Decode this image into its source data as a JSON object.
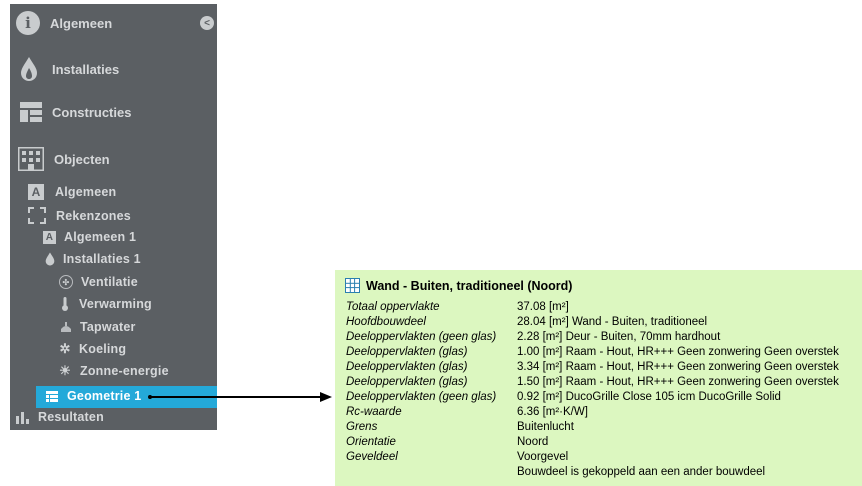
{
  "sidebar": {
    "collapse_glyph": "<",
    "sections": [
      {
        "label": "Algemeen",
        "icon": "info-icon"
      },
      {
        "label": "Installaties",
        "icon": "flame-icon"
      },
      {
        "label": "Constructies",
        "icon": "construction-icon"
      },
      {
        "label": "Objecten",
        "icon": "building-icon"
      }
    ],
    "items": [
      {
        "label": "Algemeen",
        "icon": "letter-a-icon",
        "glyph": "A"
      },
      {
        "label": "Rekenzones",
        "icon": "dashed-box-icon"
      },
      {
        "label": "Algemeen 1",
        "icon": "letter-a-icon",
        "glyph": "A"
      },
      {
        "label": "Installaties 1",
        "icon": "flame-icon"
      },
      {
        "label": "Ventilatie",
        "icon": "fan-icon"
      },
      {
        "label": "Verwarming",
        "icon": "thermometer-icon"
      },
      {
        "label": "Tapwater",
        "icon": "faucet-icon"
      },
      {
        "label": "Koeling",
        "icon": "snowflake-icon"
      },
      {
        "label": "Zonne-energie",
        "icon": "sun-icon"
      },
      {
        "label": "Geometrie 1",
        "icon": "grid-icon",
        "active": true
      },
      {
        "label": "Resultaten",
        "icon": "bar-chart-icon"
      }
    ],
    "active_color": "#24a9d9"
  },
  "panel": {
    "title": "Wand - Buiten, traditioneel (Noord)",
    "background": "#dcf7c0",
    "rows": [
      {
        "label": "Totaal oppervlakte",
        "value": "37.08 [m²]"
      },
      {
        "label": "Hoofdbouwdeel",
        "value": "28.04 [m²] Wand - Buiten, traditioneel"
      },
      {
        "label": "Deeloppervlakten (geen glas)",
        "value": "2.28 [m²] Deur - Buiten, 70mm hardhout"
      },
      {
        "label": "Deeloppervlakten (glas)",
        "value": "1.00 [m²] Raam - Hout, HR+++  Geen zonwering Geen overstek"
      },
      {
        "label": "Deeloppervlakten (glas)",
        "value": "3.34 [m²] Raam - Hout, HR+++  Geen zonwering Geen overstek"
      },
      {
        "label": "Deeloppervlakten (glas)",
        "value": "1.50 [m²] Raam - Hout, HR+++  Geen zonwering Geen overstek"
      },
      {
        "label": "Deeloppervlakten (geen glas)",
        "value": "0.92 [m²] DucoGrille Close 105 icm DucoGrille Solid"
      },
      {
        "label": "Rc-waarde",
        "value": "6.36 [m²·K/W]"
      },
      {
        "label": "Grens",
        "value": "Buitenlucht"
      },
      {
        "label": "Orientatie",
        "value": "Noord"
      },
      {
        "label": "Geveldeel",
        "value": "Voorgevel"
      },
      {
        "label": "",
        "value": "Bouwdeel is gekoppeld aan een ander bouwdeel"
      }
    ]
  }
}
